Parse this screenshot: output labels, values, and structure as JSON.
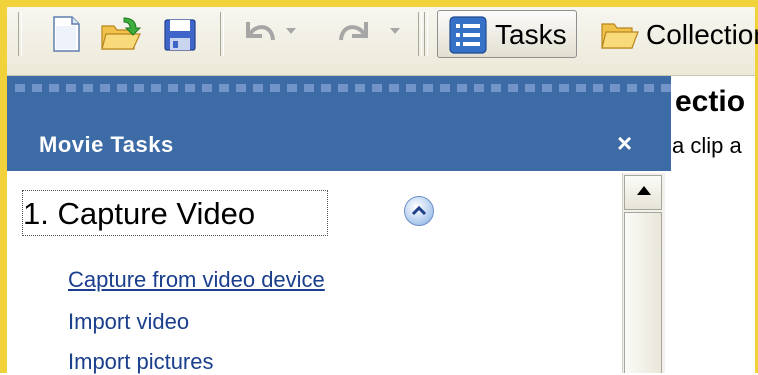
{
  "toolbar": {
    "tasks_label": "Tasks",
    "collections_label": "Collectior"
  },
  "pane": {
    "title": "Movie Tasks",
    "close_label": "×",
    "section_title": "1. Capture Video",
    "links": [
      "Capture from video device",
      "Import video",
      "Import pictures"
    ]
  },
  "content": {
    "heading": "ectio",
    "text": "a clip a"
  },
  "colors": {
    "pane_header": "#3d6ba6",
    "link": "#1a3f8c",
    "frame": "#f2d23a"
  },
  "icons": [
    "new-project-icon",
    "open-project-icon",
    "save-icon",
    "undo-icon",
    "redo-icon",
    "tasks-icon",
    "collections-icon",
    "collapse-icon"
  ]
}
